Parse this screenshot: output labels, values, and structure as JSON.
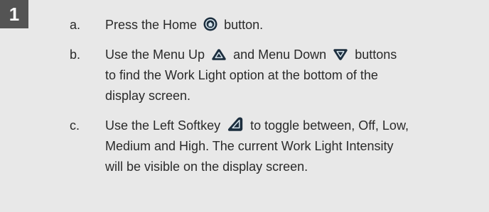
{
  "step": {
    "number": "1"
  },
  "instructions": [
    {
      "marker": "a.",
      "before_icon": "Press the Home",
      "icon": "home-button-icon",
      "after_icon": "button."
    },
    {
      "marker": "b.",
      "segment1": "Use the Menu Up",
      "icon1": "menu-up-button-icon",
      "segment2": "and Menu Down",
      "icon2": "menu-down-button-icon",
      "segment3": "buttons",
      "line2": "to find the Work Light option at the bottom of the",
      "line3": "display screen."
    },
    {
      "marker": "c.",
      "before_icon": "Use the Left Softkey",
      "icon": "left-softkey-button-icon",
      "after_icon": "to toggle between, Off, Low,",
      "line2": "Medium and High. The current Work Light Intensity",
      "line3": "will be visible on the display screen."
    }
  ],
  "colors": {
    "background": "#e8e8e8",
    "badge": "#545454",
    "text": "#2a2a2a",
    "icon_dark": "#1c2e3e",
    "icon_light": "#d8e6ee"
  }
}
